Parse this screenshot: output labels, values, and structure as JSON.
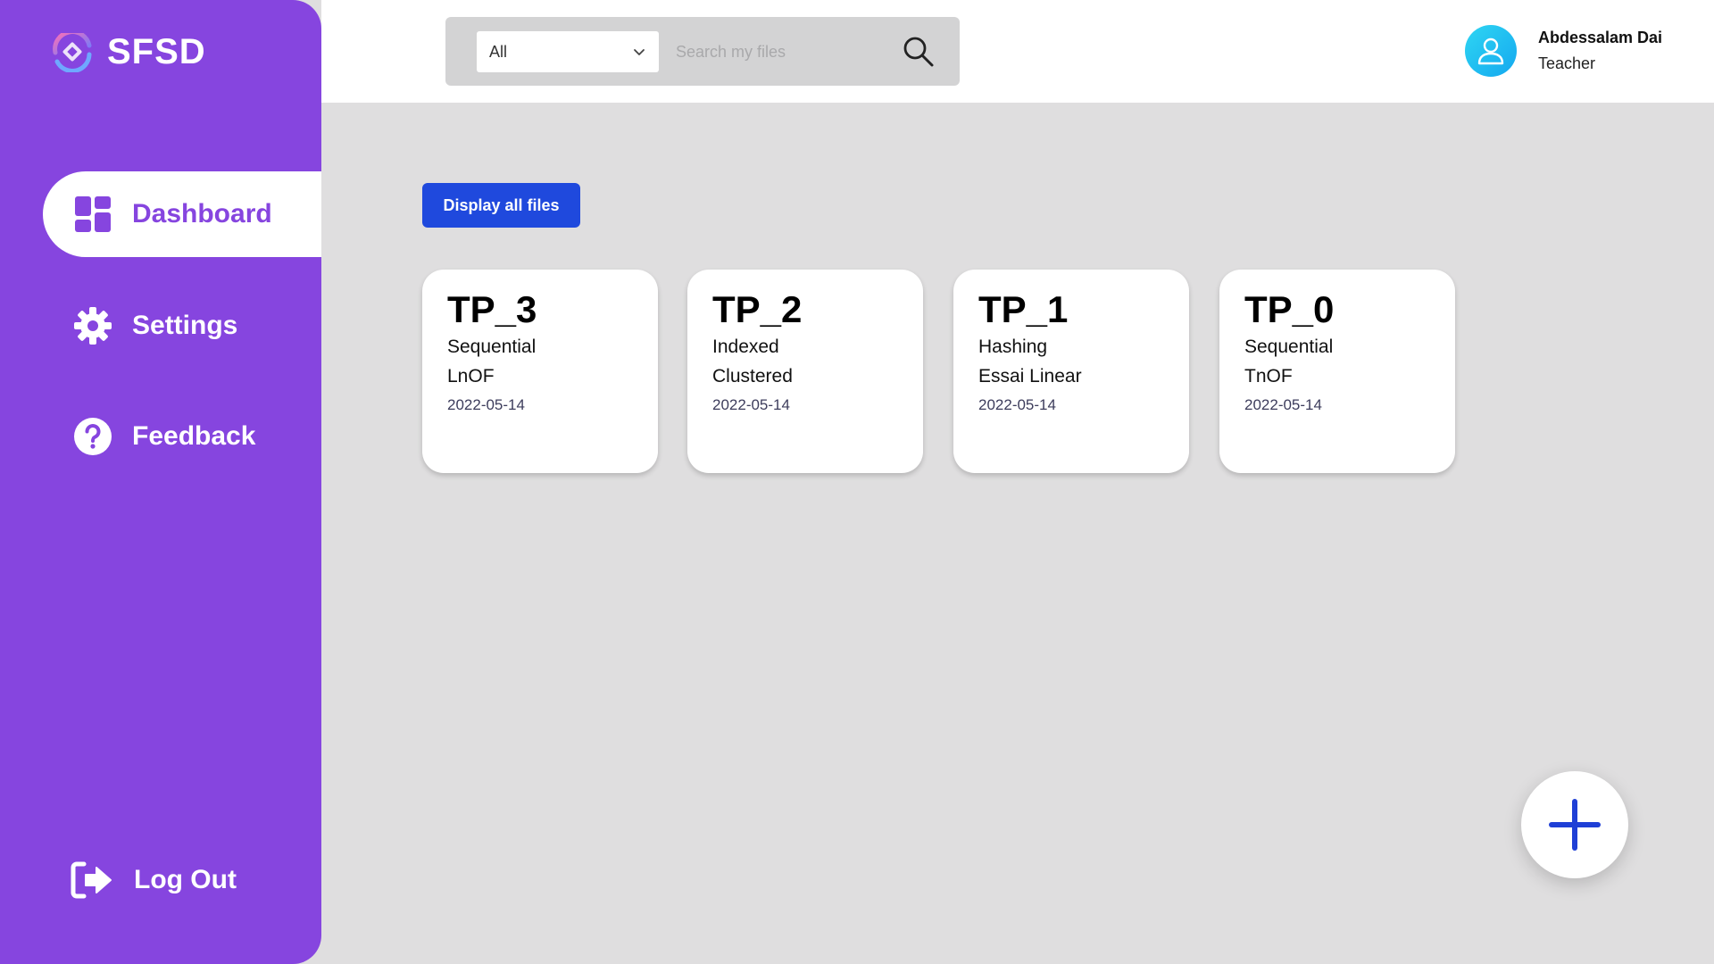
{
  "brand": {
    "name": "SFSD"
  },
  "sidebar": {
    "items": [
      {
        "label": "Dashboard",
        "icon": "dashboard-grid-icon",
        "active": true
      },
      {
        "label": "Settings",
        "icon": "gear-icon",
        "active": false
      },
      {
        "label": "Feedback",
        "icon": "question-circle-icon",
        "active": false
      }
    ],
    "logout": {
      "label": "Log Out",
      "icon": "logout-icon"
    }
  },
  "search": {
    "filter_value": "All",
    "placeholder": "Search my files",
    "value": ""
  },
  "user": {
    "name": "Abdessalam Dai",
    "role": "Teacher"
  },
  "main": {
    "display_all_label": "Display all files",
    "files": [
      {
        "title": "TP_3",
        "line1": "Sequential",
        "line2": "LnOF",
        "date": "2022-05-14"
      },
      {
        "title": "TP_2",
        "line1": "Indexed",
        "line2": "Clustered",
        "date": "2022-05-14"
      },
      {
        "title": "TP_1",
        "line1": "Hashing",
        "line2": "Essai Linear",
        "date": "2022-05-14"
      },
      {
        "title": "TP_0",
        "line1": "Sequential",
        "line2": "TnOF",
        "date": "2022-05-14"
      }
    ]
  },
  "colors": {
    "sidebar": "#8645df",
    "primary_button": "#1f49dd",
    "background": "#dfdedf",
    "avatar": "#14a8f0"
  }
}
